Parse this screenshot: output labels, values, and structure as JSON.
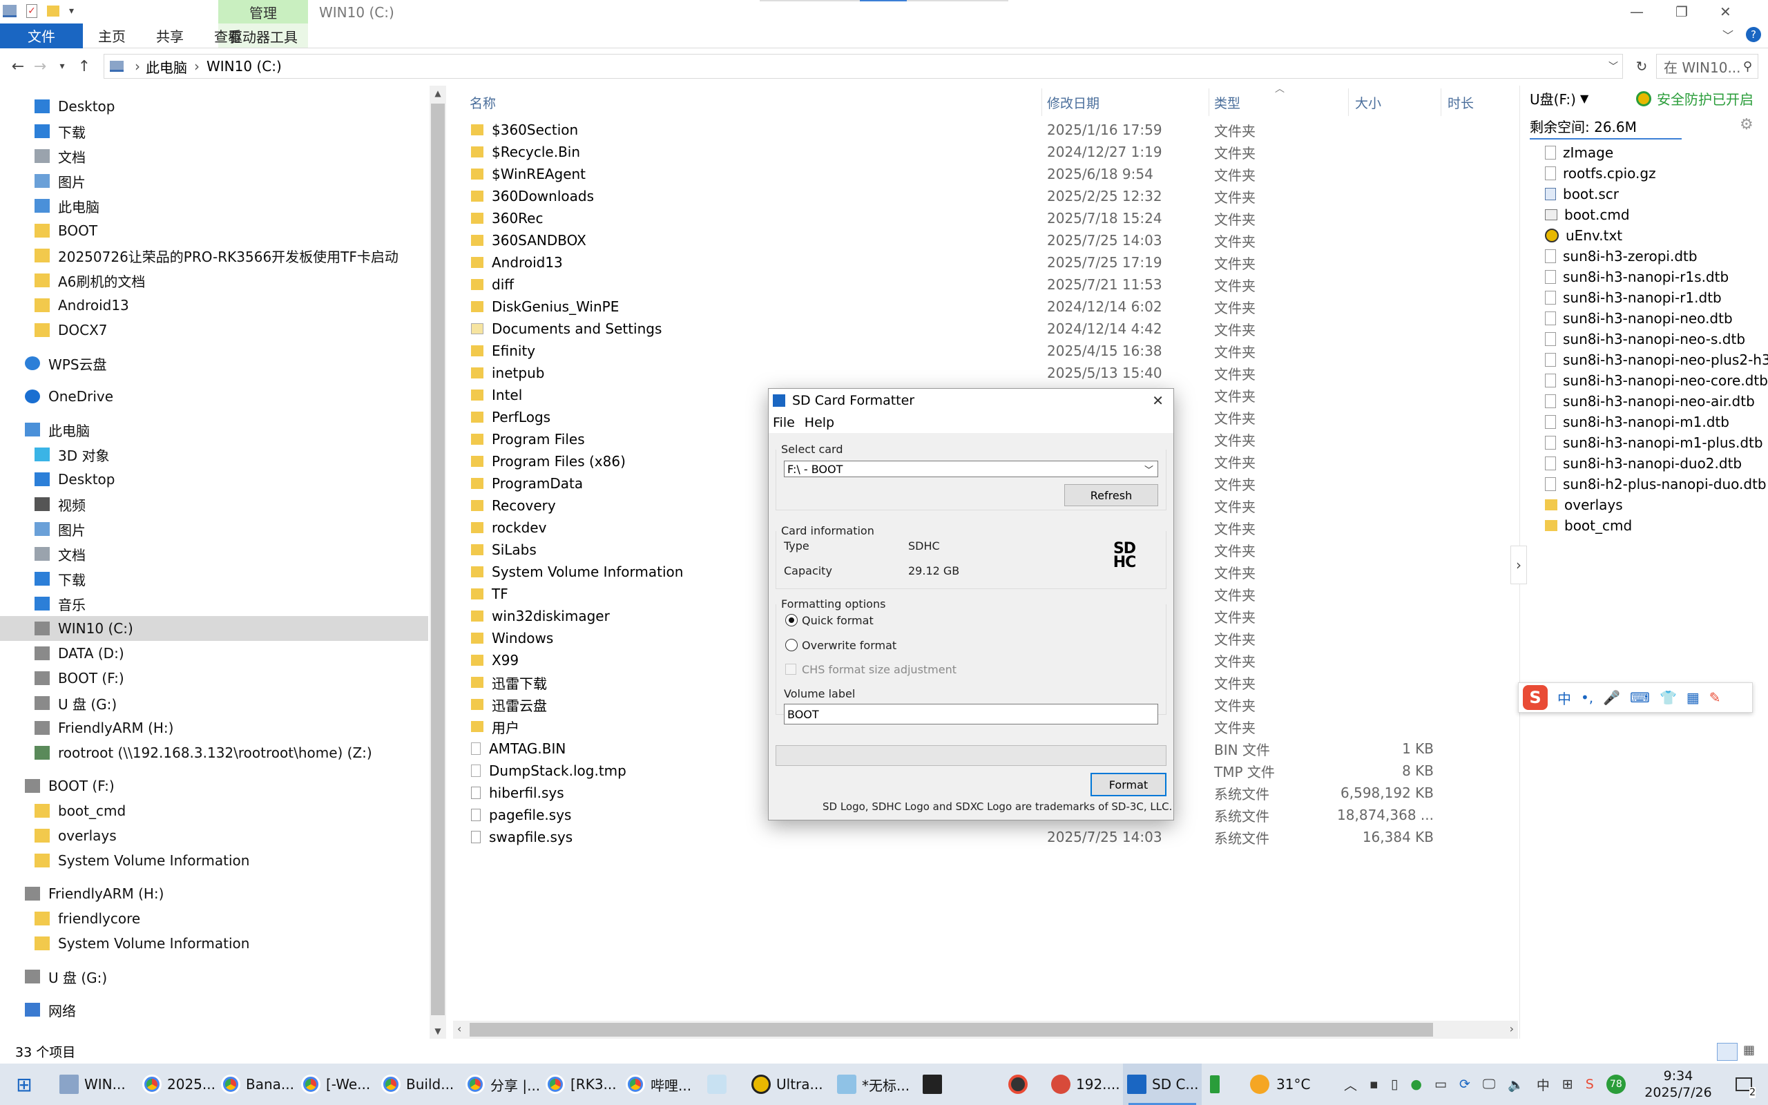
{
  "ribbon": {
    "tabs": [
      "文件",
      "主页",
      "共享",
      "查看"
    ],
    "context_group": "管理",
    "context_tab": "驱动器工具",
    "window_title": "WIN10 (C:)"
  },
  "address": {
    "crumbs": [
      "此电脑",
      "WIN10 (C:)"
    ],
    "search_placeholder": "在 WIN10..."
  },
  "nav": {
    "quick": [
      {
        "label": "Desktop",
        "icon": "desktop-icon"
      },
      {
        "label": "下载",
        "icon": "download-icon"
      },
      {
        "label": "文档",
        "icon": "document-icon"
      },
      {
        "label": "图片",
        "icon": "picture-icon"
      },
      {
        "label": "此电脑",
        "icon": "computer-icon"
      },
      {
        "label": "BOOT",
        "icon": "folder-icon"
      },
      {
        "label": "20250726让荣品的PRO-RK3566开发板使用TF卡启动",
        "icon": "folder-icon"
      },
      {
        "label": "A6刷机的文档",
        "icon": "folder-icon"
      },
      {
        "label": "Android13",
        "icon": "folder-icon"
      },
      {
        "label": "DOCX7",
        "icon": "folder-icon"
      }
    ],
    "wps": "WPS云盘",
    "onedrive": "OneDrive",
    "pc": "此电脑",
    "pc_items": [
      {
        "label": "3D 对象",
        "icon": "3d-objects-icon"
      },
      {
        "label": "Desktop",
        "icon": "desktop-icon"
      },
      {
        "label": "视频",
        "icon": "video-icon"
      },
      {
        "label": "图片",
        "icon": "picture-icon"
      },
      {
        "label": "文档",
        "icon": "document-icon"
      },
      {
        "label": "下载",
        "icon": "download-icon"
      },
      {
        "label": "音乐",
        "icon": "music-icon"
      },
      {
        "label": "WIN10 (C:)",
        "icon": "drive-icon"
      },
      {
        "label": "DATA (D:)",
        "icon": "drive-icon"
      },
      {
        "label": "BOOT (F:)",
        "icon": "drive-icon"
      },
      {
        "label": "U 盘 (G:)",
        "icon": "drive-icon"
      },
      {
        "label": "FriendlyARM (H:)",
        "icon": "drive-icon"
      },
      {
        "label": "rootroot (\\\\192.168.3.132\\rootroot\\home) (Z:)",
        "icon": "network-drive-icon"
      }
    ],
    "boot": "BOOT (F:)",
    "boot_items": [
      "boot_cmd",
      "overlays",
      "System Volume Information"
    ],
    "friendly": "FriendlyARM (H:)",
    "friendly_items": [
      "friendlycore",
      "System Volume Information"
    ],
    "udisk": "U 盘 (G:)",
    "network": "网络"
  },
  "list": {
    "headers": {
      "name": "名称",
      "date": "修改日期",
      "type": "类型",
      "size": "大小",
      "duration": "时长"
    },
    "rows": [
      {
        "name": "$360Section",
        "date": "2025/1/16 17:59",
        "type": "文件夹",
        "size": "",
        "icon": "folder"
      },
      {
        "name": "$Recycle.Bin",
        "date": "2024/12/27 1:19",
        "type": "文件夹",
        "size": "",
        "icon": "folder"
      },
      {
        "name": "$WinREAgent",
        "date": "2025/6/18 9:54",
        "type": "文件夹",
        "size": "",
        "icon": "folder"
      },
      {
        "name": "360Downloads",
        "date": "2025/2/25 12:32",
        "type": "文件夹",
        "size": "",
        "icon": "folder"
      },
      {
        "name": "360Rec",
        "date": "2025/7/18 15:24",
        "type": "文件夹",
        "size": "",
        "icon": "folder"
      },
      {
        "name": "360SANDBOX",
        "date": "2025/7/25 14:03",
        "type": "文件夹",
        "size": "",
        "icon": "folder"
      },
      {
        "name": "Android13",
        "date": "2025/7/25 17:19",
        "type": "文件夹",
        "size": "",
        "icon": "folder"
      },
      {
        "name": "diff",
        "date": "2025/7/21 11:53",
        "type": "文件夹",
        "size": "",
        "icon": "folder"
      },
      {
        "name": "DiskGenius_WinPE",
        "date": "2024/12/14 6:02",
        "type": "文件夹",
        "size": "",
        "icon": "folder"
      },
      {
        "name": "Documents and Settings",
        "date": "2024/12/14 4:42",
        "type": "文件夹",
        "size": "",
        "icon": "shortcut"
      },
      {
        "name": "Efinity",
        "date": "2025/4/15 16:38",
        "type": "文件夹",
        "size": "",
        "icon": "folder"
      },
      {
        "name": "inetpub",
        "date": "2025/5/13 15:40",
        "type": "文件夹",
        "size": "",
        "icon": "folder"
      },
      {
        "name": "Intel",
        "date": "",
        "type": "文件夹",
        "size": "",
        "icon": "folder"
      },
      {
        "name": "PerfLogs",
        "date": "",
        "type": "文件夹",
        "size": "",
        "icon": "folder"
      },
      {
        "name": "Program Files",
        "date": "",
        "type": "文件夹",
        "size": "",
        "icon": "folder"
      },
      {
        "name": "Program Files (x86)",
        "date": "",
        "type": "文件夹",
        "size": "",
        "icon": "folder"
      },
      {
        "name": "ProgramData",
        "date": "",
        "type": "文件夹",
        "size": "",
        "icon": "folder"
      },
      {
        "name": "Recovery",
        "date": "",
        "type": "文件夹",
        "size": "",
        "icon": "folder"
      },
      {
        "name": "rockdev",
        "date": "",
        "type": "文件夹",
        "size": "",
        "icon": "folder"
      },
      {
        "name": "SiLabs",
        "date": "",
        "type": "文件夹",
        "size": "",
        "icon": "folder"
      },
      {
        "name": "System Volume Information",
        "date": "",
        "type": "文件夹",
        "size": "",
        "icon": "folder"
      },
      {
        "name": "TF",
        "date": "",
        "type": "文件夹",
        "size": "",
        "icon": "folder"
      },
      {
        "name": "win32diskimager",
        "date": "",
        "type": "文件夹",
        "size": "",
        "icon": "folder"
      },
      {
        "name": "Windows",
        "date": "",
        "type": "文件夹",
        "size": "",
        "icon": "folder"
      },
      {
        "name": "X99",
        "date": "",
        "type": "文件夹",
        "size": "",
        "icon": "folder"
      },
      {
        "name": "迅雷下载",
        "date": "",
        "type": "文件夹",
        "size": "",
        "icon": "folder"
      },
      {
        "name": "迅雷云盘",
        "date": "",
        "type": "文件夹",
        "size": "",
        "icon": "folder"
      },
      {
        "name": "用户",
        "date": "",
        "type": "文件夹",
        "size": "",
        "icon": "folder"
      },
      {
        "name": "AMTAG.BIN",
        "date": "",
        "type": "BIN 文件",
        "size": "1 KB",
        "icon": "file"
      },
      {
        "name": "DumpStack.log.tmp",
        "date": "",
        "type": "TMP 文件",
        "size": "8 KB",
        "icon": "file"
      },
      {
        "name": "hiberfil.sys",
        "date": "",
        "type": "系统文件",
        "size": "6,598,192 KB",
        "icon": "sysfile"
      },
      {
        "name": "pagefile.sys",
        "date": "",
        "type": "系统文件",
        "size": "18,874,368 ...",
        "icon": "sysfile"
      },
      {
        "name": "swapfile.sys",
        "date": "2025/7/25 14:03",
        "type": "系统文件",
        "size": "16,384 KB",
        "icon": "sysfile"
      }
    ]
  },
  "right": {
    "drive": "U盘(F:)",
    "protect": "安全防护已开启",
    "free_space": "剩余空间: 26.6M",
    "files": [
      {
        "name": "zImage",
        "icon": "file"
      },
      {
        "name": "rootfs.cpio.gz",
        "icon": "file"
      },
      {
        "name": "boot.scr",
        "icon": "script"
      },
      {
        "name": "boot.cmd",
        "icon": "cmd"
      },
      {
        "name": "uEnv.txt",
        "icon": "ue"
      },
      {
        "name": "sun8i-h3-zeropi.dtb",
        "icon": "file"
      },
      {
        "name": "sun8i-h3-nanopi-r1s.dtb",
        "icon": "file"
      },
      {
        "name": "sun8i-h3-nanopi-r1.dtb",
        "icon": "file"
      },
      {
        "name": "sun8i-h3-nanopi-neo.dtb",
        "icon": "file"
      },
      {
        "name": "sun8i-h3-nanopi-neo-s.dtb",
        "icon": "file"
      },
      {
        "name": "sun8i-h3-nanopi-neo-plus2-h3...",
        "icon": "file"
      },
      {
        "name": "sun8i-h3-nanopi-neo-core.dtb",
        "icon": "file"
      },
      {
        "name": "sun8i-h3-nanopi-neo-air.dtb",
        "icon": "file"
      },
      {
        "name": "sun8i-h3-nanopi-m1.dtb",
        "icon": "file"
      },
      {
        "name": "sun8i-h3-nanopi-m1-plus.dtb",
        "icon": "file"
      },
      {
        "name": "sun8i-h3-nanopi-duo2.dtb",
        "icon": "file"
      },
      {
        "name": "sun8i-h2-plus-nanopi-duo.dtb",
        "icon": "file"
      },
      {
        "name": "overlays",
        "icon": "folder"
      },
      {
        "name": "boot_cmd",
        "icon": "folder"
      }
    ]
  },
  "dialog": {
    "title": "SD Card Formatter",
    "menu": [
      "File",
      "Help"
    ],
    "select_card_label": "Select card",
    "selected_card": "F:\\ - BOOT",
    "refresh": "Refresh",
    "card_info_label": "Card information",
    "type_label": "Type",
    "type_value": "SDHC",
    "capacity_label": "Capacity",
    "capacity_value": "29.12 GB",
    "sd_logo": "SD HC",
    "options_label": "Formatting options",
    "quick": "Quick format",
    "overwrite": "Overwrite format",
    "chs": "CHS format size adjustment",
    "volume_label": "Volume label",
    "volume_value": "BOOT",
    "format": "Format",
    "trademark": "SD Logo, SDHC Logo and SDXC Logo are trademarks of SD-3C, LLC."
  },
  "status": {
    "count": "33 个项目"
  },
  "taskbar": {
    "items": [
      "WIN...",
      "2025...",
      "Bana...",
      "[-We...",
      "Build...",
      "分享 |...",
      "[RK3...",
      "哔哩...",
      "",
      "Ultra...",
      "*无标...",
      "",
      "",
      "",
      "192....",
      "SD C..."
    ],
    "weather": "31°C",
    "time": "9:34",
    "date": "2025/7/26",
    "notif": "2",
    "battery": "78"
  },
  "colors": {
    "accent": "#1a66c2",
    "folder": "#f2c94c",
    "ctx": "#c9efc0"
  }
}
